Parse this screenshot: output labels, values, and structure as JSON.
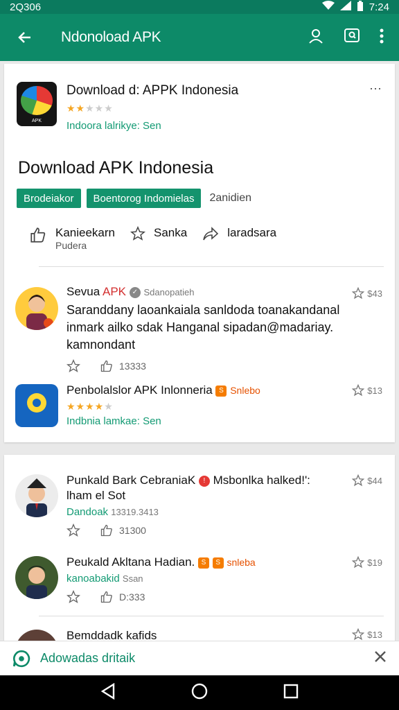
{
  "status": {
    "left": "2Q306",
    "time": "7:24"
  },
  "appbar": {
    "title": "Ndonoload APK"
  },
  "app": {
    "name": "Download d: APPK Indonesia",
    "icon_label": "APK",
    "rating": 2,
    "sub": "Indoora lalrikye: Sen"
  },
  "headline": "Download APK Indonesia",
  "chips": [
    "Brodeiakor",
    "Boentorog  Indomielas"
  ],
  "chip_extra": "2anidien",
  "actions": {
    "like_label": "Kanieekarn",
    "like_sub": "Pudera",
    "star_label": "Sanka",
    "share_label": "laradsara"
  },
  "review1": {
    "name": "Sevua",
    "name_red": "APK",
    "handle": "Sdanopatieh",
    "text": "Saranddany laoankaiala sanldoda toanakandanal inmark ailko sdak Hanganal sipadan@madariay. kamnondant",
    "likes": "13333",
    "score": "$43"
  },
  "app2": {
    "name": "Penbolalslor APK Inlonneria",
    "tag": "Snlebo",
    "icon_label": "Sodsana",
    "rating": 4,
    "sub": "Indbnia lamkae: Sen",
    "score": "$13"
  },
  "review2": {
    "name": "Punkald  Bark CebraniaK",
    "extra": "Msbonlka halked!':",
    "name2": "lham el Sot",
    "sub_green": "Dandoak",
    "sub_grey": "13319.3413",
    "likes": "31300",
    "score": "$44"
  },
  "review3": {
    "name": "Peukald Akltana Hadian.",
    "tag": "snleba",
    "sub_green": "kanoabakid",
    "sub_grey": "Ssan",
    "likes": "D:333",
    "score": "$19"
  },
  "review4": {
    "name": "Bemddadk kafids",
    "score": "$13"
  },
  "snackbar": {
    "text": "Adowadas dritaik"
  },
  "colors": {
    "primary": "#0d8a68",
    "accent": "#14936d",
    "star": "#f5a623"
  }
}
